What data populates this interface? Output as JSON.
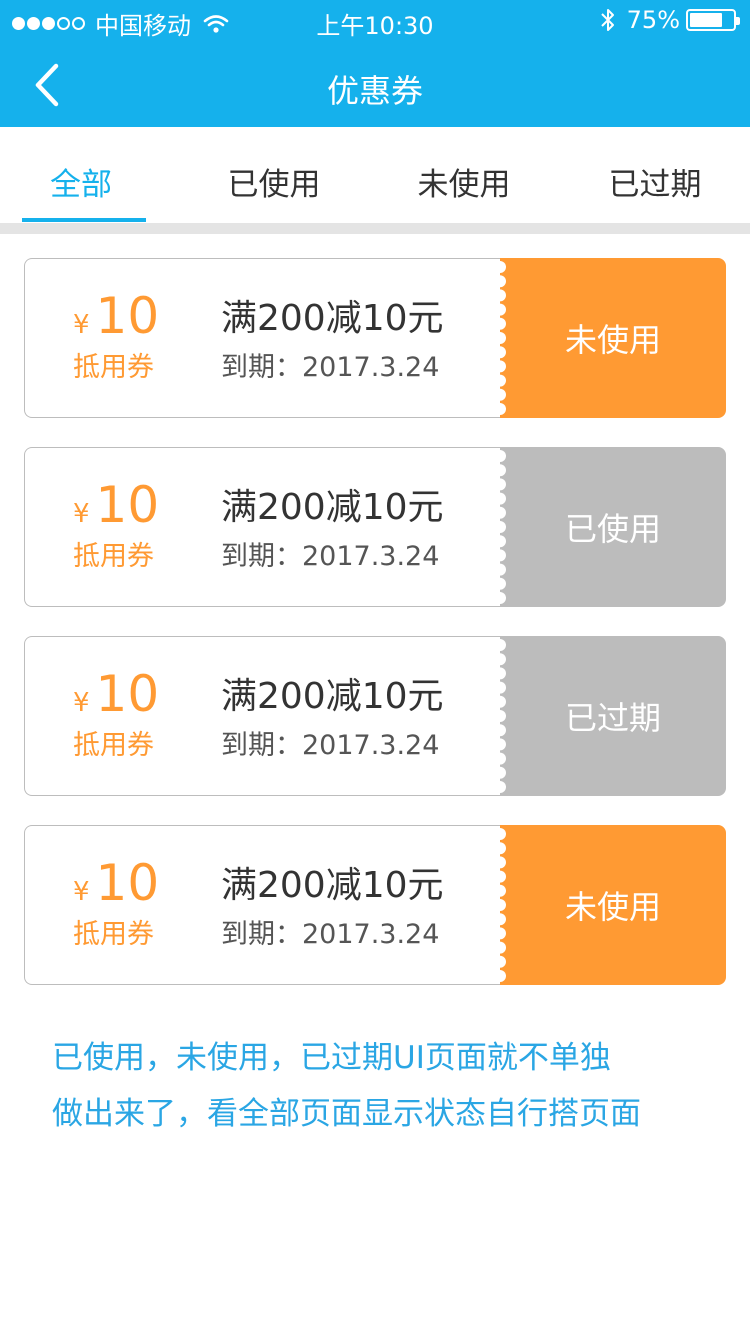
{
  "status_bar": {
    "carrier": "中国移动",
    "time": "上午10:30",
    "battery": "75%",
    "battery_level": 0.75,
    "signal_bars": 3,
    "signal_total": 5
  },
  "header": {
    "title": "优惠券",
    "back_icon": "chevron-left-icon"
  },
  "tabs": [
    {
      "label": "全部",
      "active": true
    },
    {
      "label": "已使用",
      "active": false
    },
    {
      "label": "未使用",
      "active": false
    },
    {
      "label": "已过期",
      "active": false
    }
  ],
  "coupons": [
    {
      "currency": "¥",
      "amount": "10",
      "type": "抵用券",
      "name": "满200减10元",
      "expiry": "到期：2017.3.24",
      "status": "未使用",
      "status_color": "#ff9a33"
    },
    {
      "currency": "¥",
      "amount": "10",
      "type": "抵用券",
      "name": "满200减10元",
      "expiry": "到期：2017.3.24",
      "status": "已使用",
      "status_color": "#bcbcbc"
    },
    {
      "currency": "¥",
      "amount": "10",
      "type": "抵用券",
      "name": "满200减10元",
      "expiry": "到期：2017.3.24",
      "status": "已过期",
      "status_color": "#bcbcbc"
    },
    {
      "currency": "¥",
      "amount": "10",
      "type": "抵用券",
      "name": "满200减10元",
      "expiry": "到期：2017.3.24",
      "status": "未使用",
      "status_color": "#ff9a33"
    }
  ],
  "note_lines": [
    "已使用，未使用，已过期UI页面就不单独",
    "做出来了，看全部页面显示状态自行搭页面"
  ],
  "colors": {
    "primary": "#15b1ec",
    "accent": "#ff9a33",
    "disabled": "#bcbcbc"
  }
}
